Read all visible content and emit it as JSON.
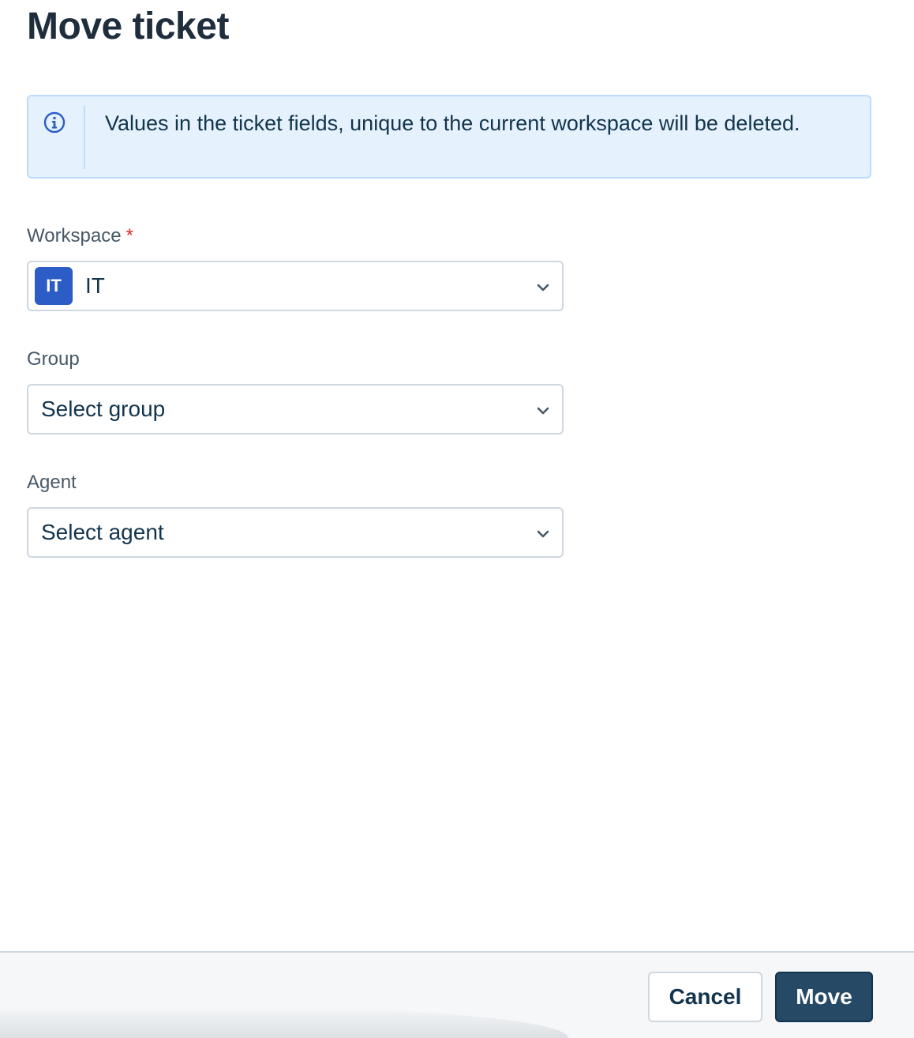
{
  "dialog": {
    "title": "Move ticket"
  },
  "info_banner": {
    "message": "Values in the ticket fields, unique to the current workspace will be deleted."
  },
  "fields": {
    "workspace": {
      "label": "Workspace",
      "required_marker": "*",
      "badge": "IT",
      "value": "IT"
    },
    "group": {
      "label": "Group",
      "placeholder": "Select group"
    },
    "agent": {
      "label": "Agent",
      "placeholder": "Select agent"
    }
  },
  "footer": {
    "cancel_label": "Cancel",
    "move_label": "Move"
  },
  "colors": {
    "banner_background": "#e5f2fd",
    "banner_border": "#bbdcfe",
    "info_icon": "#2c5cc5",
    "workspace_badge": "#2c5cc5",
    "required": "#d72d30",
    "primary_button": "#264966"
  },
  "icons": {
    "info": "info-circle-icon",
    "dropdown": "chevron-down-icon"
  }
}
